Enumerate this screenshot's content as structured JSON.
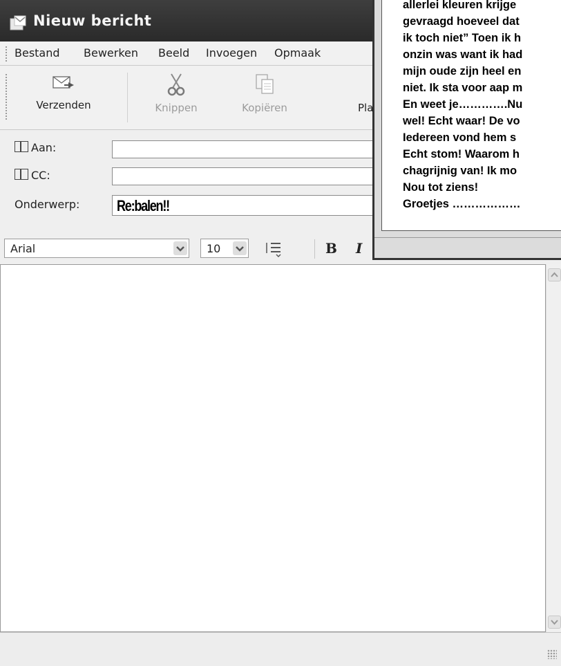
{
  "window": {
    "title": "Nieuw bericht"
  },
  "menu": [
    "Bestand",
    "Bewerken",
    "Beeld",
    "Invoegen",
    "Opmaak"
  ],
  "toolbar": {
    "send_label": "Verzenden",
    "cut_label": "Knippen",
    "copy_label": "Kopiëren",
    "paste_label": "Pla"
  },
  "header": {
    "to_label": "Aan:",
    "cc_label": "CC:",
    "subject_label": "Onderwerp:",
    "to_value": "",
    "cc_value": "",
    "subject_value": "Re:balen!!"
  },
  "format": {
    "font_name": "Arial",
    "font_size": "10",
    "bold": "B",
    "italic": "I"
  },
  "overlay": {
    "lines": [
      "allerlei kleuren krijge",
      "gevraagd hoeveel dat",
      "ik toch niet” Toen ik h",
      "onzin was want ik had",
      "mijn oude zijn heel en",
      "niet. Ik sta voor  aap m",
      "En weet je………….Nu",
      "wel! Echt waar! De vo",
      "Iedereen vond hem s",
      "Echt stom! Waarom h",
      "chagrijnig van! Ik mo",
      "Nou tot ziens!",
      "Groetjes ………………"
    ]
  },
  "icons": {
    "title": "new-message-icon",
    "send": "send-envelope-icon",
    "cut": "scissors-icon",
    "copy": "copy-icon",
    "paste": "clipboard-icon",
    "line_spacing": "line-spacing-icon",
    "address_book": "address-book-icon"
  }
}
